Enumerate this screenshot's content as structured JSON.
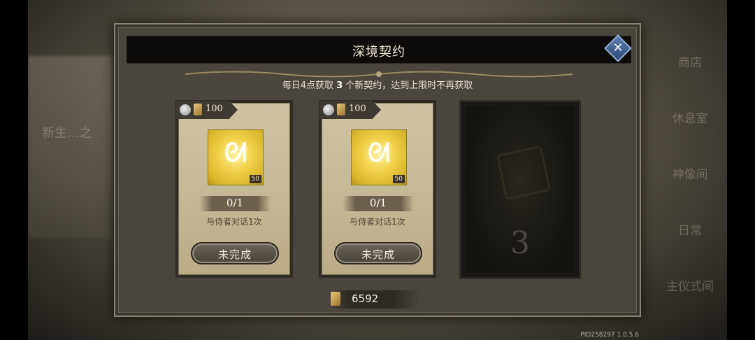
{
  "background": {
    "left_text": "新生...之",
    "left_subtext": "...",
    "right_menu": [
      "商店",
      "休息室",
      "神像间",
      "日常",
      "主仪式间"
    ]
  },
  "dialog": {
    "title": "深境契约",
    "close_icon": "close-icon",
    "info_prefix": "每日4点获取",
    "info_count": "3",
    "info_suffix": "个新契约，达到上限时不再获取"
  },
  "contracts": [
    {
      "cost": "100",
      "reward_count": "50",
      "progress": "0/1",
      "task": "与侍者对话1次",
      "status": "未完成"
    },
    {
      "cost": "100",
      "reward_count": "50",
      "progress": "0/1",
      "task": "与侍者对话1次",
      "status": "未完成"
    }
  ],
  "locked_slot": {
    "number": "3"
  },
  "currency": {
    "value": "6592"
  },
  "pid": "PID258297  1.0.5.6",
  "colors": {
    "title_bar": "#0d0c0a",
    "card": "#c4b794",
    "reward_gold": "#f1d24a",
    "close_button": "#3e6297"
  }
}
